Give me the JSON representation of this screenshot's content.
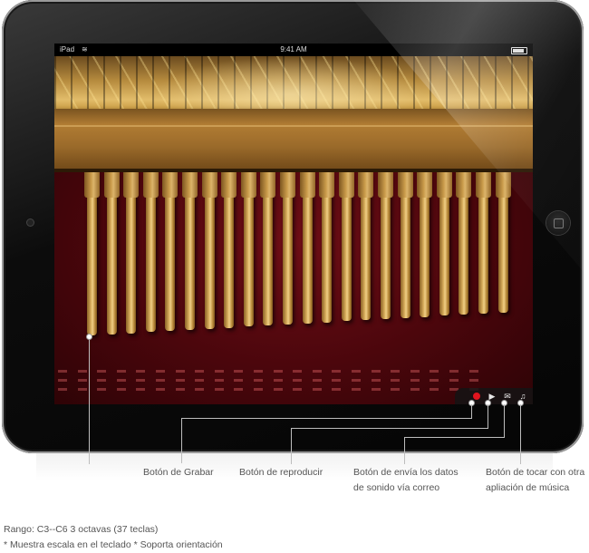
{
  "status_bar": {
    "carrier": "iPad",
    "time": "9:41 AM"
  },
  "toolbar": {
    "record_icon": "record-icon",
    "play_icon": "play-icon",
    "mail_icon": "mail-icon",
    "music_icon": "music-note-icon",
    "record_color": "#e0141e"
  },
  "music_box": {
    "tooth_count": 22,
    "felt_color": "#4b060c",
    "wood_color": "#d8ad5c"
  },
  "callouts": {
    "record": "Botón de Grabar",
    "play": "Botón de reproducir",
    "mail_line1": "Botón de envía los datos",
    "mail_line2": "de sonido vía correo",
    "music_line1": "Botón de tocar con otra",
    "music_line2": "apliación de música"
  },
  "footer": {
    "range": "Rango: C3--C6 3 octavas (37 teclas)",
    "notes": "* Muestra escala en el teclado   * Soporta orientación"
  }
}
